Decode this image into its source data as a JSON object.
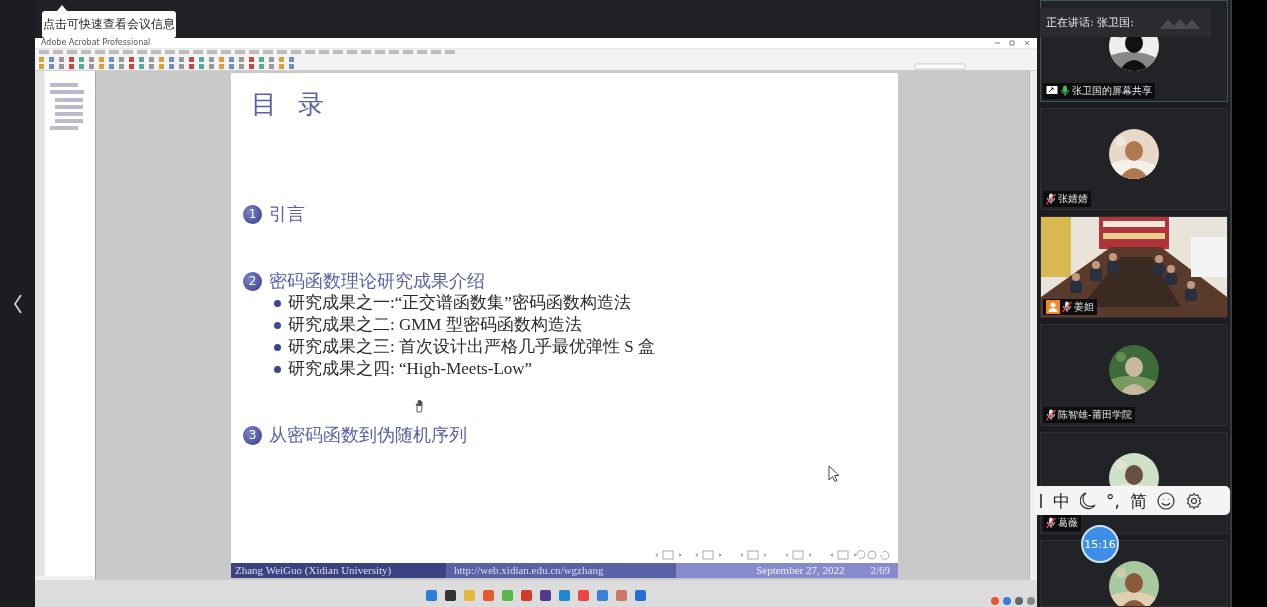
{
  "meeting": {
    "tooltip": "点击可快速查看会议信息",
    "speaker_banner": "正在讲话: 张卫国:",
    "timer": "15:16"
  },
  "acrobat": {
    "title": "Adobe Acrobat Professional"
  },
  "slide": {
    "title": "目 录",
    "sections": [
      {
        "number": "1",
        "title": "引言"
      },
      {
        "number": "2",
        "title": "密码函数理论研究成果介绍",
        "bullets": [
          "研究成果之一:“正交谱函数集”密码函数构造法",
          "研究成果之二: GMM 型密码函数构造法",
          "研究成果之三: 首次设计出严格几乎最优弹性 S 盒",
          "研究成果之四: “High-Meets-Low”"
        ]
      },
      {
        "number": "3",
        "title": "从密码函数到伪随机序列"
      }
    ],
    "footer": {
      "author": "Zhang WeiGuo (Xidian University)",
      "url": "http://web.xidian.edu.cn/wgzhang",
      "date": "September 27, 2022",
      "page": "2/69"
    }
  },
  "participants": [
    {
      "name": "张卫国的屏幕共享",
      "kind": "avatar",
      "muted": false,
      "sharing": true,
      "host": false
    },
    {
      "name": "张婧婧",
      "kind": "avatar",
      "muted": true,
      "sharing": false,
      "host": false
    },
    {
      "name": "姜妲",
      "kind": "video",
      "muted": true,
      "sharing": false,
      "host": true
    },
    {
      "name": "陈智雄-莆田学院",
      "kind": "avatar",
      "muted": true,
      "sharing": false,
      "host": false
    },
    {
      "name": "葛薇",
      "kind": "avatar",
      "muted": true,
      "sharing": false,
      "host": false
    },
    {
      "kind": "avatar"
    }
  ],
  "ime_toolbar": {
    "mode": "中",
    "punctuation": "°,",
    "script": "简"
  }
}
